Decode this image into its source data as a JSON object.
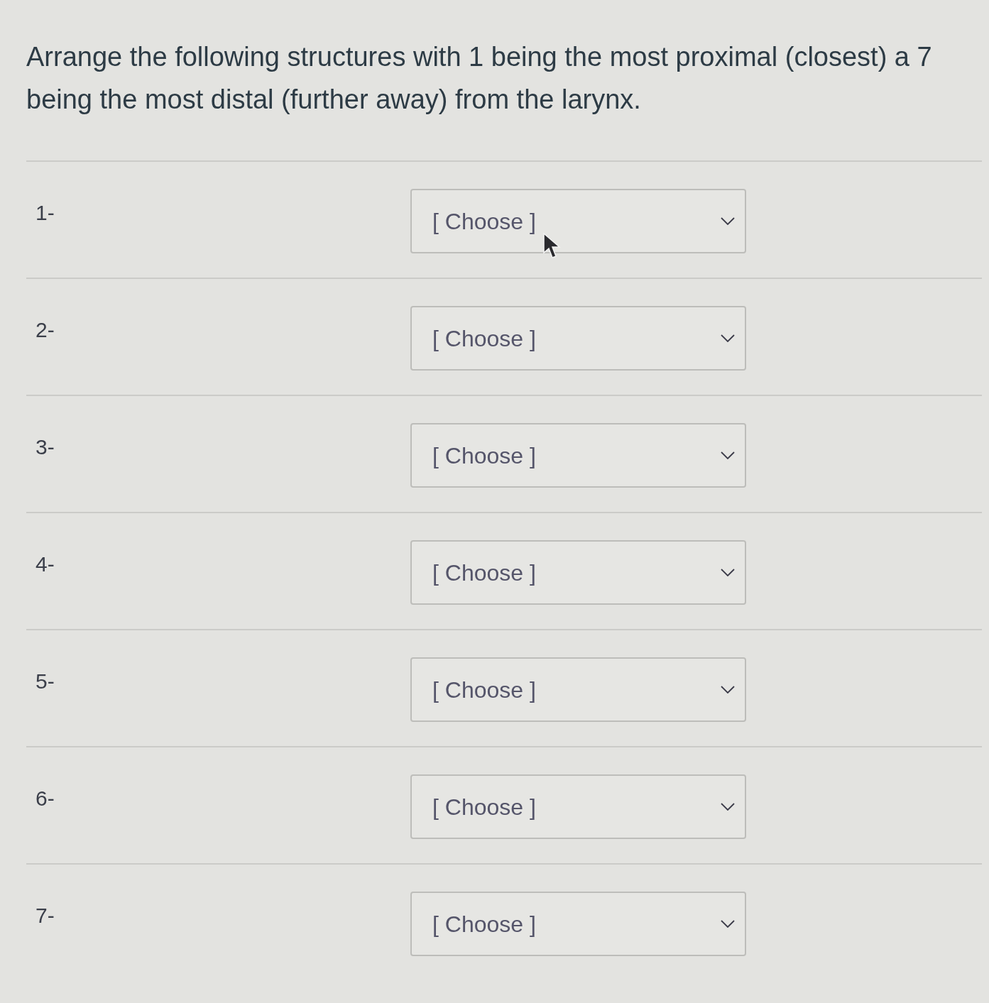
{
  "question": "Arrange the following structures with 1 being the most proximal (closest) a 7 being the most distal (further away) from the larynx.",
  "items": [
    {
      "label": "1-",
      "value": "[ Choose ]",
      "hovered": true
    },
    {
      "label": "2-",
      "value": "[ Choose ]",
      "hovered": false
    },
    {
      "label": "3-",
      "value": "[ Choose ]",
      "hovered": false
    },
    {
      "label": "4-",
      "value": "[ Choose ]",
      "hovered": false
    },
    {
      "label": "5-",
      "value": "[ Choose ]",
      "hovered": false
    },
    {
      "label": "6-",
      "value": "[ Choose ]",
      "hovered": false
    },
    {
      "label": "7-",
      "value": "[ Choose ]",
      "hovered": false
    }
  ]
}
